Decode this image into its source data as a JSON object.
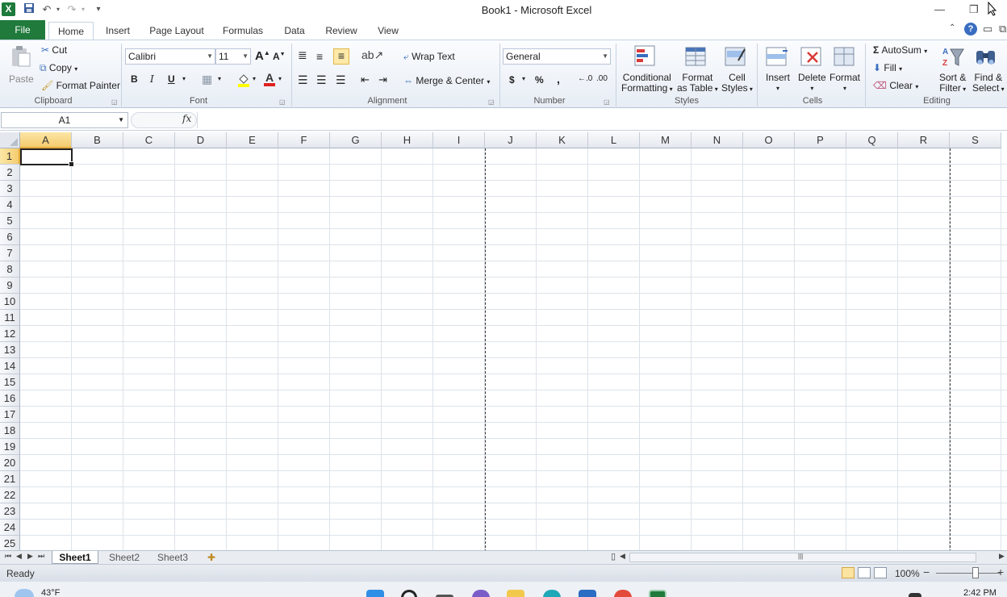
{
  "window": {
    "title": "Book1  -  Microsoft Excel",
    "app_logo": "X"
  },
  "ribbon_tabs": [
    "File",
    "Home",
    "Insert",
    "Page Layout",
    "Formulas",
    "Data",
    "Review",
    "View"
  ],
  "active_tab": "Home",
  "clipboard": {
    "paste": "Paste",
    "cut": "Cut",
    "copy": "Copy",
    "format_painter": "Format Painter",
    "group_label": "Clipboard"
  },
  "font": {
    "name": "Calibri",
    "size": "11",
    "bold": "B",
    "italic": "I",
    "underline": "U",
    "grow": "A",
    "shrink": "A",
    "group_label": "Font"
  },
  "alignment": {
    "wrap_text": "Wrap Text",
    "merge_center": "Merge & Center",
    "group_label": "Alignment"
  },
  "number": {
    "format": "General",
    "currency": "$",
    "percent": "%",
    "comma": ",",
    "inc_decimal": "←.0",
    "dec_decimal": ".00",
    "group_label": "Number"
  },
  "styles": {
    "conditional_1": "Conditional",
    "conditional_2": "Formatting",
    "format_table_1": "Format",
    "format_table_2": "as Table",
    "cell_styles_1": "Cell",
    "cell_styles_2": "Styles",
    "group_label": "Styles"
  },
  "cells": {
    "insert": "Insert",
    "delete": "Delete",
    "format": "Format",
    "group_label": "Cells"
  },
  "editing": {
    "autosum": "AutoSum",
    "sigma": "Σ",
    "fill": "Fill",
    "clear": "Clear",
    "sort_1": "Sort &",
    "sort_2": "Filter",
    "find_1": "Find &",
    "find_2": "Select",
    "group_label": "Editing"
  },
  "formula_bar": {
    "name_box": "A1",
    "fx": "fx",
    "value": ""
  },
  "grid": {
    "columns": [
      "A",
      "B",
      "C",
      "D",
      "E",
      "F",
      "G",
      "H",
      "I",
      "J",
      "K",
      "L",
      "M",
      "N",
      "O",
      "P",
      "Q",
      "R",
      "S"
    ],
    "rows": [
      "1",
      "2",
      "3",
      "4",
      "5",
      "6",
      "7",
      "8",
      "9",
      "10",
      "11",
      "12",
      "13",
      "14",
      "15",
      "16",
      "17",
      "18",
      "19",
      "20",
      "21",
      "22",
      "23",
      "24",
      "25"
    ],
    "active_cell": "A1"
  },
  "sheets": {
    "tabs": [
      "Sheet1",
      "Sheet2",
      "Sheet3"
    ],
    "active": "Sheet1"
  },
  "status": {
    "ready": "Ready",
    "zoom": "100%",
    "zoom_minus": "−",
    "zoom_plus": "+"
  },
  "taskbar": {
    "temperature": "43°F",
    "time": "2:42 PM"
  },
  "colors": {
    "file_tab": "#1f7a3c",
    "selected_header": "#f4cc6e",
    "accent_blue": "#3a6dbf"
  }
}
